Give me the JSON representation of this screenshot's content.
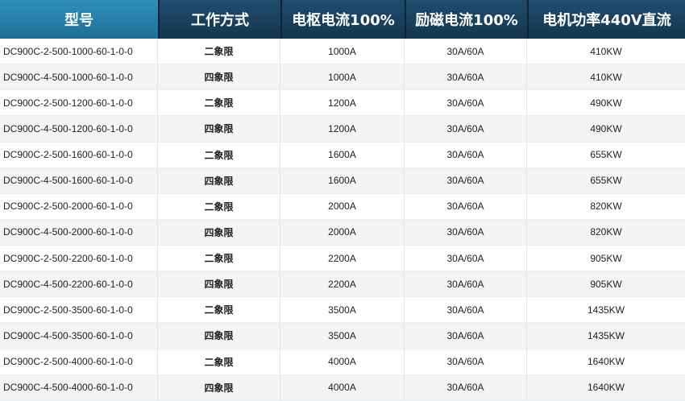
{
  "table": {
    "headers": [
      "型号",
      "工作方式",
      "电枢电流100%",
      "励磁电流100%",
      "电机功率440V直流"
    ],
    "rows": [
      [
        "DC900C-2-500-1000-60-1-0-0",
        "二象限",
        "1000A",
        "30A/60A",
        "410KW"
      ],
      [
        "DC900C-4-500-1000-60-1-0-0",
        "四象限",
        "1000A",
        "30A/60A",
        "410KW"
      ],
      [
        "DC900C-2-500-1200-60-1-0-0",
        "二象限",
        "1200A",
        "30A/60A",
        "490KW"
      ],
      [
        "DC900C-4-500-1200-60-1-0-0",
        "四象限",
        "1200A",
        "30A/60A",
        "490KW"
      ],
      [
        "DC900C-2-500-1600-60-1-0-0",
        "二象限",
        "1600A",
        "30A/60A",
        "655KW"
      ],
      [
        "DC900C-4-500-1600-60-1-0-0",
        "四象限",
        "1600A",
        "30A/60A",
        "655KW"
      ],
      [
        "DC900C-2-500-2000-60-1-0-0",
        "二象限",
        "2000A",
        "30A/60A",
        "820KW"
      ],
      [
        "DC900C-4-500-2000-60-1-0-0",
        "四象限",
        "2000A",
        "30A/60A",
        "820KW"
      ],
      [
        "DC900C-2-500-2200-60-1-0-0",
        "二象限",
        "2200A",
        "30A/60A",
        "905KW"
      ],
      [
        "DC900C-4-500-2200-60-1-0-0",
        "四象限",
        "2200A",
        "30A/60A",
        "905KW"
      ],
      [
        "DC900C-2-500-3500-60-1-0-0",
        "二象限",
        "3500A",
        "30A/60A",
        "1435KW"
      ],
      [
        "DC900C-4-500-3500-60-1-0-0",
        "四象限",
        "3500A",
        "30A/60A",
        "1435KW"
      ],
      [
        "DC900C-2-500-4000-60-1-0-0",
        "二象限",
        "4000A",
        "30A/60A",
        "1640KW"
      ],
      [
        "DC900C-4-500-4000-60-1-0-0",
        "四象限",
        "4000A",
        "30A/60A",
        "1640KW"
      ]
    ]
  },
  "colors": {
    "header_bg": "#1a4260",
    "header_model_bg": "#2680ad",
    "header_text": "#ffffff",
    "row_alt_bg": "#f2f4f6"
  }
}
